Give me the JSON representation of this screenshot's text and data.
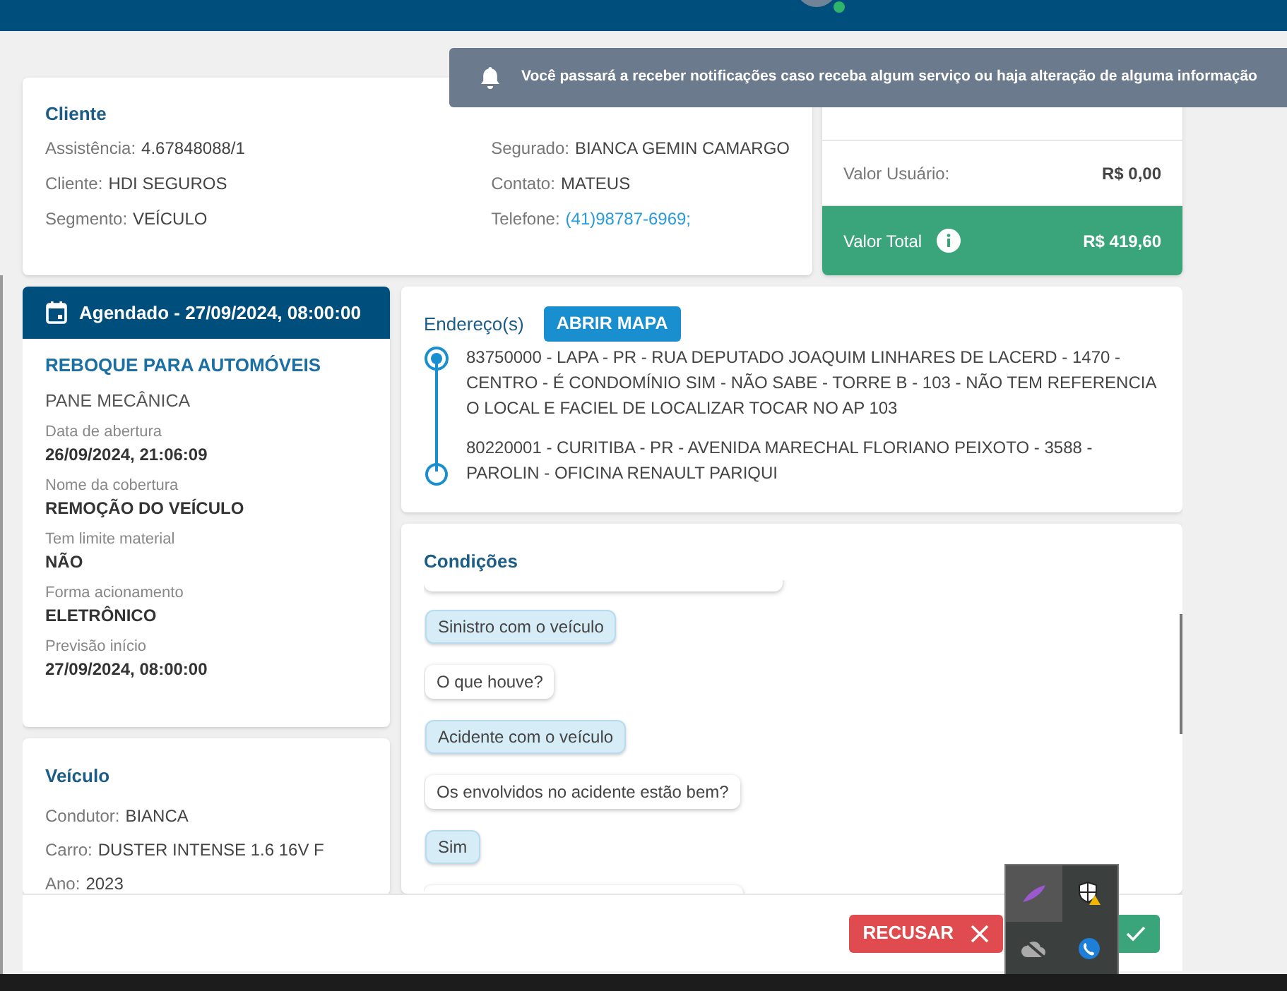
{
  "notification": {
    "text": "Você passará a receber notificações caso receba algum serviço ou haja alteração de alguma informação"
  },
  "client": {
    "title": "Cliente",
    "left": [
      {
        "label": "Assistência:",
        "value": "4.67848088/1"
      },
      {
        "label": "Cliente:",
        "value": "HDI SEGUROS"
      },
      {
        "label": "Segmento:",
        "value": "VEÍCULO"
      }
    ],
    "right": [
      {
        "label": "Segurado:",
        "value": "BIANCA GEMIN CAMARGO"
      },
      {
        "label": "Contato:",
        "value": "MATEUS"
      },
      {
        "label": "Telefone:",
        "value": "(41)98787-6969;",
        "kind": "link"
      }
    ]
  },
  "values": [
    {
      "label": "Valor Usuário:",
      "value": "R$ 0,00",
      "kind": "plain"
    },
    {
      "label": "Valor Total",
      "value": "R$ 419,60",
      "kind": "total"
    }
  ],
  "schedule": {
    "title": "Agendado - 27/09/2024, 08:00:00",
    "service": "REBOQUE PARA AUTOMÓVEIS",
    "problem": "PANE MECÂNICA",
    "fields": [
      {
        "label": "Data de abertura",
        "value": "26/09/2024, 21:06:09"
      },
      {
        "label": "Nome da cobertura",
        "value": "REMOÇÃO DO VEÍCULO"
      },
      {
        "label": "Tem limite material",
        "value": "NÃO"
      },
      {
        "label": "Forma acionamento",
        "value": "ELETRÔNICO"
      },
      {
        "label": "Previsão início",
        "value": "27/09/2024, 08:00:00"
      }
    ]
  },
  "vehicle": {
    "title": "Veículo",
    "fields": [
      {
        "label": "Condutor:",
        "value": "BIANCA"
      },
      {
        "label": "Carro:",
        "value": "DUSTER INTENSE 1.6 16V F"
      },
      {
        "label": "Ano:",
        "value": "2023"
      }
    ]
  },
  "addresses": {
    "title": "Endereço(s)",
    "button": "ABRIR MAPA",
    "items": [
      {
        "text": "83750000 - LAPA - PR - RUA DEPUTADO JOAQUIM LINHARES DE LACERD - 1470 - CENTRO - É CONDOMÍNIO SIM - NÃO SABE - TORRE B - 103 - NÃO TEM REFERENCIA O LOCAL E FACIEL DE LOCALIZAR TOCAR NO AP 103",
        "kind": "origin"
      },
      {
        "text": "80220001 - CURITIBA - PR - AVENIDA MARECHAL FLORIANO PEIXOTO - 3588 - PAROLIN - OFICINA RENAULT PARIQUI",
        "kind": "destination"
      }
    ]
  },
  "conditions": {
    "title": "Condições",
    "messages": [
      {
        "text": "Sinistro com o veículo",
        "kind": "answer"
      },
      {
        "text": "O que houve?",
        "kind": "question"
      },
      {
        "text": "Acidente com o veículo",
        "kind": "answer"
      },
      {
        "text": "Os envolvidos no acidente estão bem?",
        "kind": "question"
      },
      {
        "text": "Sim",
        "kind": "answer"
      }
    ]
  },
  "footer": {
    "reject": "RECUSAR"
  }
}
